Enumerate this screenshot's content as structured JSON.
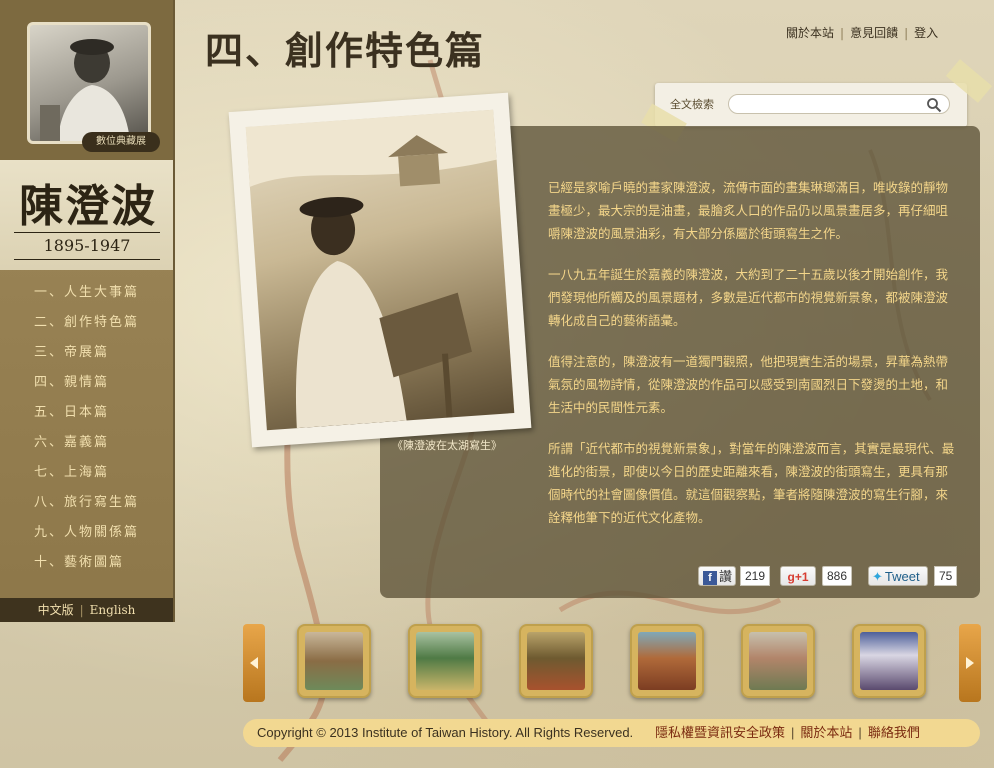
{
  "site": {
    "archive_label": "數位典藏展",
    "artist_name": "陳澄波",
    "artist_years": "1895-1947"
  },
  "header": {
    "page_title": "四、創作特色篇",
    "top_links": [
      "關於本站",
      "意見回饋",
      "登入"
    ]
  },
  "search": {
    "label": "全文檢索",
    "placeholder": ""
  },
  "sidebar": {
    "items": [
      {
        "label": "一、人生大事篇"
      },
      {
        "label": "二、創作特色篇"
      },
      {
        "label": "三、帝展篇"
      },
      {
        "label": "四、親情篇"
      },
      {
        "label": "五、日本篇"
      },
      {
        "label": "六、嘉義篇"
      },
      {
        "label": "七、上海篇"
      },
      {
        "label": "八、旅行寫生篇"
      },
      {
        "label": "九、人物關係篇"
      },
      {
        "label": "十、藝術圖篇"
      }
    ],
    "lang_zh": "中文版",
    "lang_en": "English"
  },
  "main": {
    "photo_caption": "《陳澄波在太湖寫生》",
    "paragraphs": [
      "已經是家喻戶曉的畫家陳澄波，流傳市面的畫集琳瑯滿目，唯收錄的靜物畫極少，最大宗的是油畫，最膾炙人口的作品仍以風景畫居多，再仔細咀嚼陳澄波的風景油彩，有大部分係屬於街頭寫生之作。",
      "一八九五年誕生於嘉義的陳澄波，大約到了二十五歲以後才開始創作，我們發現他所觸及的風景題材，多數是近代都市的視覺新景象，都被陳澄波轉化成自己的藝術語彙。",
      "值得注意的，陳澄波有一道獨門觀照，他把現實生活的場景，昇華為熱帶氣氛的風物詩情，從陳澄波的作品可以感受到南國烈日下發燙的土地，和生活中的民間性元素。",
      "所謂「近代都市的視覺新景象」，對當年的陳澄波而言，其實是最現代、最進化的街景，即使以今日的歷史距離來看，陳澄波的街頭寫生，更具有那個時代的社會圖像價值。就這個觀察點，筆者將隨陳澄波的寫生行腳，來詮釋他筆下的近代文化產物。"
    ]
  },
  "social": {
    "fb_label": "讚",
    "fb_count": "219",
    "gplus_label": "+1",
    "gplus_count": "886",
    "tweet_label": "Tweet",
    "tweet_count": "75"
  },
  "footer": {
    "copyright": "Copyright © 2013 Institute of Taiwan History. All Rights Reserved.",
    "links": [
      "隱私權暨資訊安全政策",
      "關於本站",
      "聯絡我們"
    ]
  },
  "colors": {
    "sidebar": "#8a7448",
    "panel": "#5c5237",
    "article_text": "#f4d68a",
    "nav_text": "#f1dfae",
    "footer_bg": "#f2d891",
    "accent": "#b8761e"
  }
}
